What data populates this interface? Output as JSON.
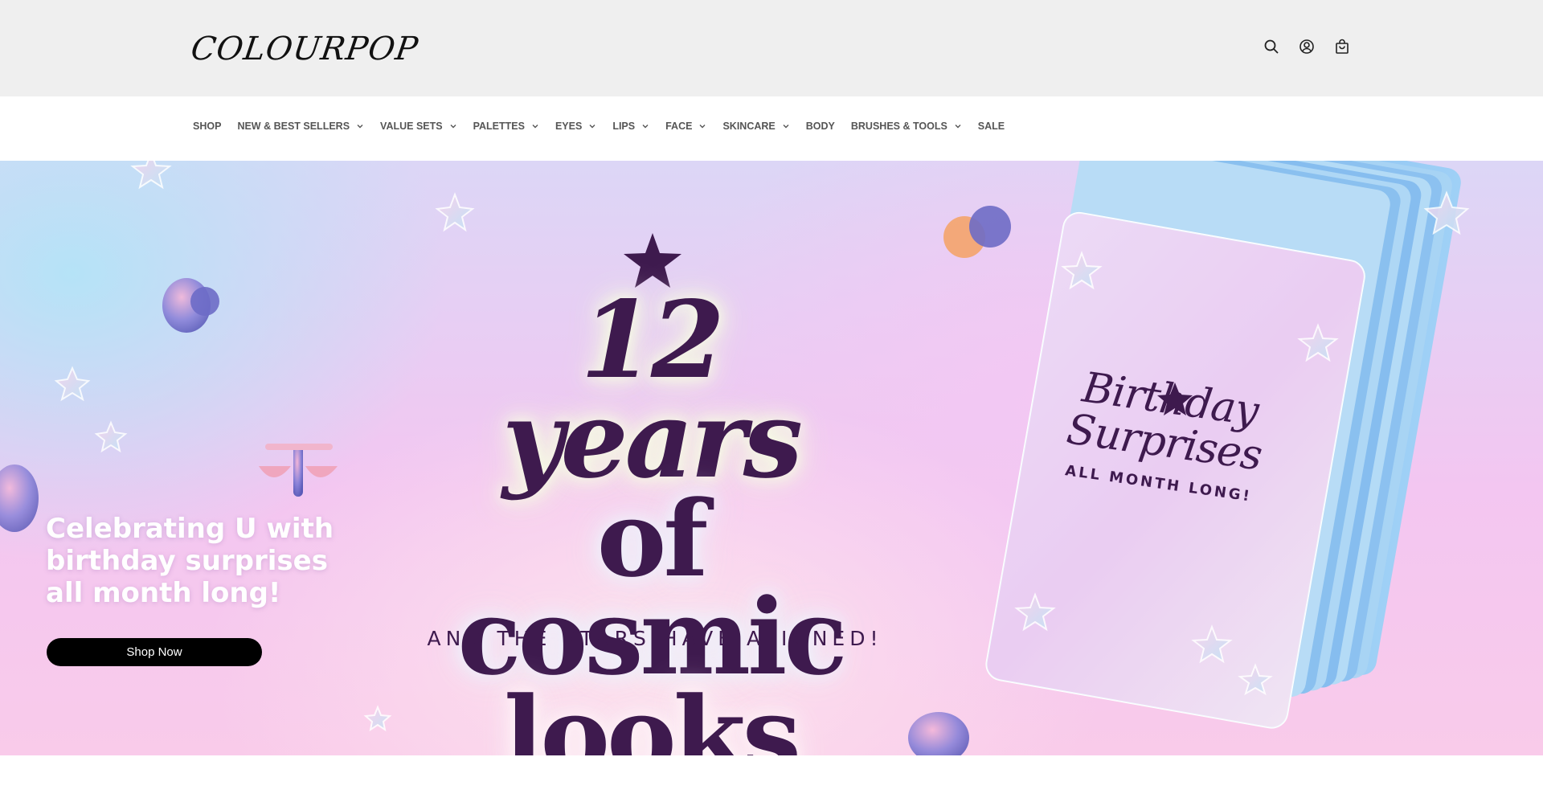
{
  "header": {
    "logo_text": "COLOURPOP",
    "icons": [
      "search-icon",
      "account-icon",
      "cart-icon"
    ]
  },
  "nav": {
    "items": [
      {
        "label": "SHOP",
        "has_dropdown": false
      },
      {
        "label": "NEW & BEST SELLERS",
        "has_dropdown": true
      },
      {
        "label": "VALUE SETS",
        "has_dropdown": true
      },
      {
        "label": "PALETTES",
        "has_dropdown": true
      },
      {
        "label": "EYES",
        "has_dropdown": true
      },
      {
        "label": "LIPS",
        "has_dropdown": true
      },
      {
        "label": "FACE",
        "has_dropdown": true
      },
      {
        "label": "SKINCARE",
        "has_dropdown": true
      },
      {
        "label": "BODY",
        "has_dropdown": false
      },
      {
        "label": "BRUSHES & TOOLS",
        "has_dropdown": true
      },
      {
        "label": "SALE",
        "has_dropdown": false
      }
    ]
  },
  "hero": {
    "headline_line1": "12 years",
    "headline_line2": "of cosmic",
    "headline_line3": "looks",
    "tagline": "AND THE STARS HAVE ALIGNED!",
    "card_title": "Birthday Surprises",
    "card_subtitle": "ALL MONTH LONG!",
    "promo_text": "Celebrating U with birthday surprises all month long!",
    "cta_label": "Shop Now"
  },
  "colors": {
    "headline": "#3e1a4e",
    "header_bg": "#efefef",
    "cta_bg": "#000000",
    "nav_text": "#555555"
  }
}
